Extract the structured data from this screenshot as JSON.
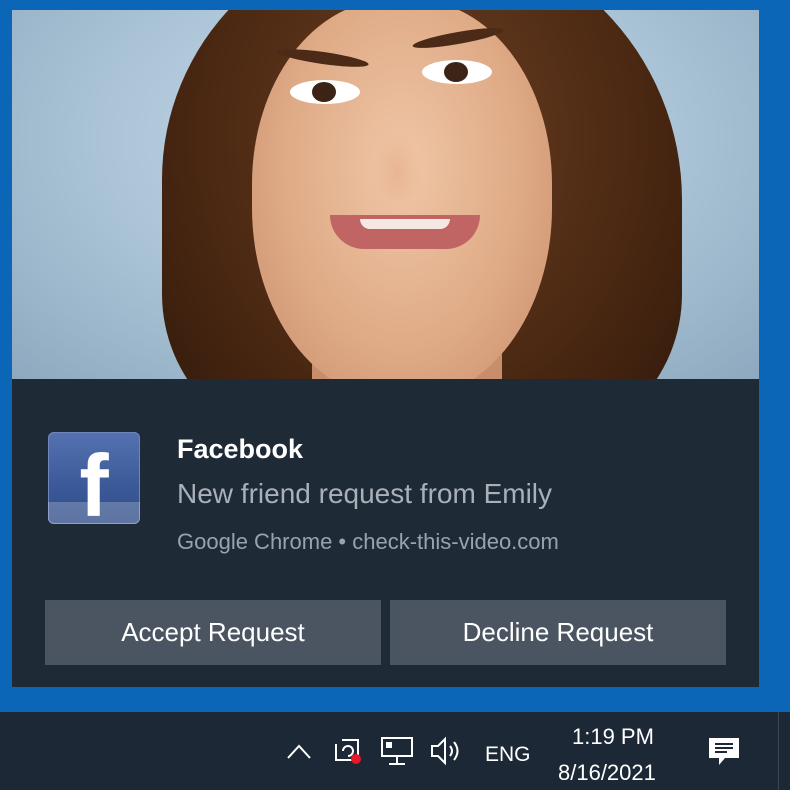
{
  "notification": {
    "title": "Facebook",
    "message": "New friend request from Emily",
    "attribution": "Google Chrome • check-this-video.com",
    "app_icon": "facebook-icon",
    "app_icon_glyph": "f",
    "buttons": {
      "accept": "Accept Request",
      "decline": "Decline Request"
    }
  },
  "taskbar": {
    "language": "ENG",
    "time": "1:19 PM",
    "date": "8/16/2021",
    "icons": [
      "chevron-up-icon",
      "sync-icon",
      "network-icon",
      "volume-icon",
      "action-center-icon"
    ]
  },
  "colors": {
    "background": "#0b66b8",
    "toast": "#1e2a36",
    "button": "#4a5561",
    "taskbar": "#1c2835",
    "facebook": "#3b5998",
    "alert_dot": "#e5192a"
  }
}
